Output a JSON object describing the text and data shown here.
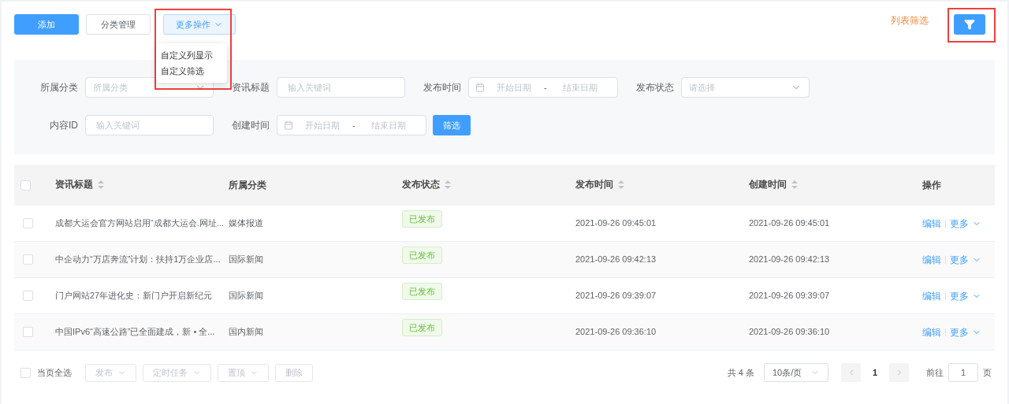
{
  "toolbar": {
    "buttons": [
      {
        "label": "添加",
        "kind": "primary"
      },
      {
        "label": "分类管理",
        "kind": "default"
      },
      {
        "label": "更多操作",
        "kind": "dropdown"
      }
    ],
    "dropdown_menu": [
      "自定义列显示",
      "自定义筛选"
    ],
    "list_filter_label": "列表筛选"
  },
  "filters": [
    [
      {
        "label": "所属分类",
        "kind": "select",
        "placeholder": "所属分类"
      },
      {
        "label": "资讯标题",
        "kind": "text",
        "placeholder": "输入关键词"
      },
      {
        "label": "发布时间",
        "kind": "daterange",
        "start_placeholder": "开始日期",
        "separator": "-",
        "end_placeholder": "结束日期"
      },
      {
        "label": "发布状态",
        "kind": "select",
        "placeholder": "请选择"
      }
    ],
    [
      {
        "label": "内容ID",
        "kind": "text",
        "placeholder": "输入关键词"
      },
      {
        "label": "创建时间",
        "kind": "daterange",
        "start_placeholder": "开始日期",
        "separator": "-",
        "end_placeholder": "结束日期"
      },
      {
        "kind": "button",
        "label": "筛选"
      }
    ]
  ],
  "table": {
    "columns": [
      {
        "label": "资讯标题",
        "sortable": true
      },
      {
        "label": "所属分类",
        "sortable": false
      },
      {
        "label": "发布状态",
        "sortable": true
      },
      {
        "label": "发布时间",
        "sortable": true
      },
      {
        "label": "创建时间",
        "sortable": true
      },
      {
        "label": "操作",
        "sortable": false
      }
    ],
    "header_checked": false,
    "rows": [
      {
        "checked": false,
        "title": "成都大运会官方网站启用“成都大运会.网址...",
        "category": "媒体报道",
        "status": "已发布",
        "published": "2021-09-26 09:45:01",
        "created": "2021-09-26 09:45:01",
        "actions": [
          "编辑",
          "更多"
        ]
      },
      {
        "checked": false,
        "title": "中企动力“万店奔流”计划：扶持1万企业店...",
        "category": "国际新闻",
        "status": "已发布",
        "published": "2021-09-26 09:42:13",
        "created": "2021-09-26 09:42:13",
        "actions": [
          "编辑",
          "更多"
        ]
      },
      {
        "checked": false,
        "title": "门户网站27年进化史：新门户开启新纪元",
        "category": "国际新闻",
        "status": "已发布",
        "published": "2021-09-26 09:39:07",
        "created": "2021-09-26 09:39:07",
        "actions": [
          "编辑",
          "更多"
        ]
      },
      {
        "checked": false,
        "title": "中国IPv6“高速公路”已全面建成，新 • 全...",
        "category": "国内新闻",
        "status": "已发布",
        "published": "2021-09-26 09:36:10",
        "created": "2021-09-26 09:36:10",
        "actions": [
          "编辑",
          "更多"
        ]
      }
    ]
  },
  "footer": {
    "select_all": {
      "label": "当页全选",
      "checked": false
    },
    "bulk_actions": [
      {
        "label": "发布",
        "dropdown": true
      },
      {
        "label": "定时任务",
        "dropdown": true
      },
      {
        "label": "置顶",
        "dropdown": true
      },
      {
        "label": "删除",
        "dropdown": false
      }
    ],
    "total": "共 4 条",
    "page_size": "10条/页",
    "pages": [
      {
        "label": "1",
        "selected": true
      }
    ],
    "goto_label": "前往",
    "goto_value": "1",
    "goto_suffix": "页"
  }
}
